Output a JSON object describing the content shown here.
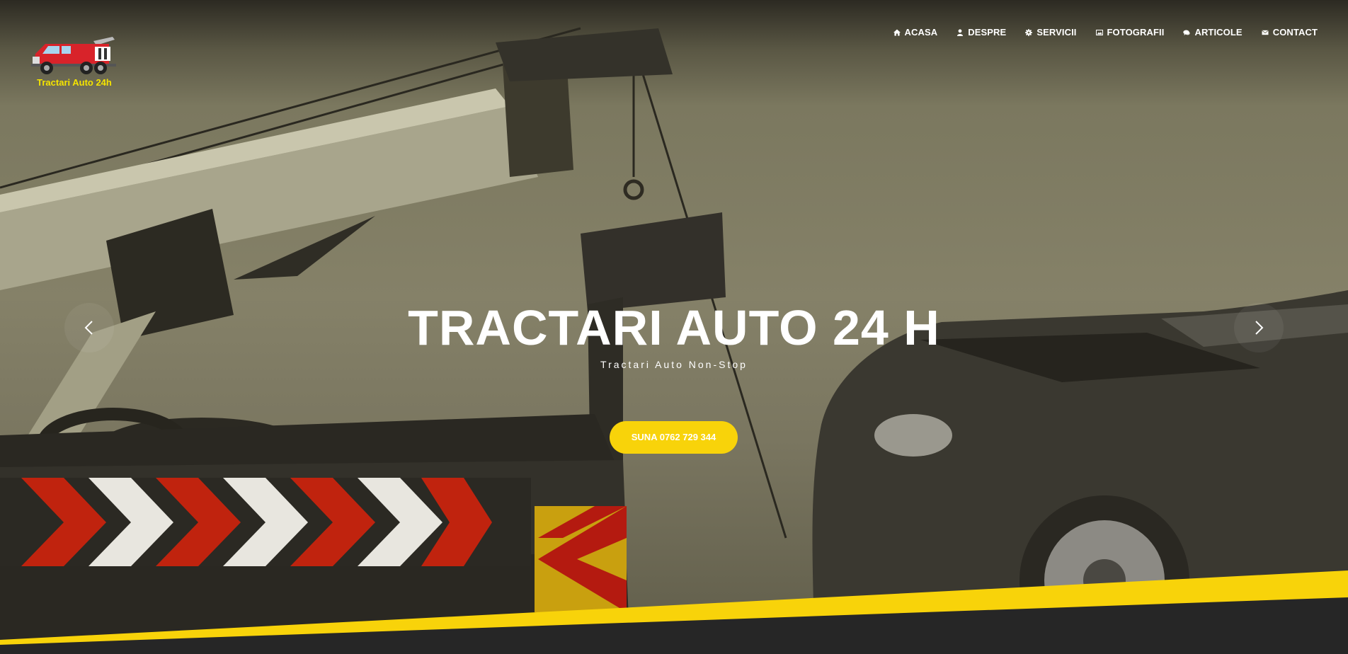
{
  "brand": {
    "logo_text": "Tractari Auto 24h",
    "logo_icon": "tow-truck-icon",
    "logo_text_color": "#f5e400"
  },
  "nav": {
    "items": [
      {
        "label": "ACASA",
        "icon": "home-icon"
      },
      {
        "label": "DESPRE",
        "icon": "user-icon"
      },
      {
        "label": "SERVICII",
        "icon": "gear-icon"
      },
      {
        "label": "FOTOGRAFII",
        "icon": "image-icon"
      },
      {
        "label": "ARTICOLE",
        "icon": "comments-icon"
      },
      {
        "label": "CONTACT",
        "icon": "envelope-icon"
      }
    ]
  },
  "hero": {
    "title": "TRACTARI AUTO 24 H",
    "subtitle": "Tractari Auto Non-Stop",
    "cta_label": "SUNA 0762 729 344",
    "prev_icon": "chevron-left-icon",
    "next_icon": "chevron-right-icon"
  },
  "colors": {
    "accent": "#f8d30a",
    "footer_band": "#262626"
  }
}
